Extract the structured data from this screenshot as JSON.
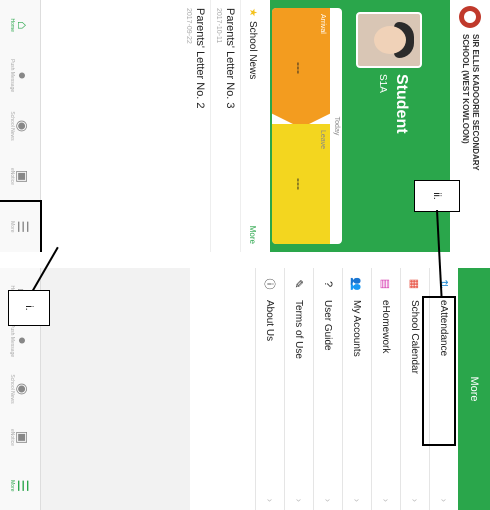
{
  "school": {
    "name_line1": "SIR ELLIS KADOORIE SECONDARY",
    "name_line2": "SCHOOL (WEST KOWLOON)"
  },
  "student": {
    "name": "Student",
    "class": "S1A"
  },
  "attendance": {
    "today_label": "Today",
    "arrival_label": "Arrival",
    "arrival_value": "---",
    "leave_label": "Leave",
    "leave_value": "---"
  },
  "news": {
    "header": "School News",
    "more": "More",
    "items": [
      {
        "title": "Parents' Letter No. 3",
        "date": "2017-10-11"
      },
      {
        "title": "Parents' Letter No. 2",
        "date": "2017-09-22"
      }
    ]
  },
  "tabs": [
    {
      "label": "Home",
      "icon": "home-icon"
    },
    {
      "label": "Push Message",
      "icon": "chat-icon"
    },
    {
      "label": "School News",
      "icon": "broadcast-icon"
    },
    {
      "label": "eNotice",
      "icon": "notice-icon"
    },
    {
      "label": "More",
      "icon": "menu-icon"
    }
  ],
  "more": {
    "title": "More",
    "items": [
      {
        "label": "eAttendance",
        "icon": "arrows-icon",
        "color": "#2a8fd6"
      },
      {
        "label": "School Calendar",
        "icon": "calendar-icon",
        "color": "#e74c3c"
      },
      {
        "label": "eHomework",
        "icon": "homework-icon",
        "color": "#d63ab0"
      },
      {
        "label": "My Accounts",
        "icon": "accounts-icon",
        "color": "#555555"
      },
      {
        "label": "User Guide",
        "icon": "guide-icon",
        "color": "#555555"
      },
      {
        "label": "Terms of Use",
        "icon": "terms-icon",
        "color": "#555555"
      },
      {
        "label": "About Us",
        "icon": "info-icon",
        "color": "#555555"
      }
    ]
  },
  "callouts": {
    "c1": "i.",
    "c2": "ii."
  },
  "colors": {
    "brand_green": "#2aa64b",
    "arrival": "#f39c1f",
    "leave": "#f3d61f"
  }
}
